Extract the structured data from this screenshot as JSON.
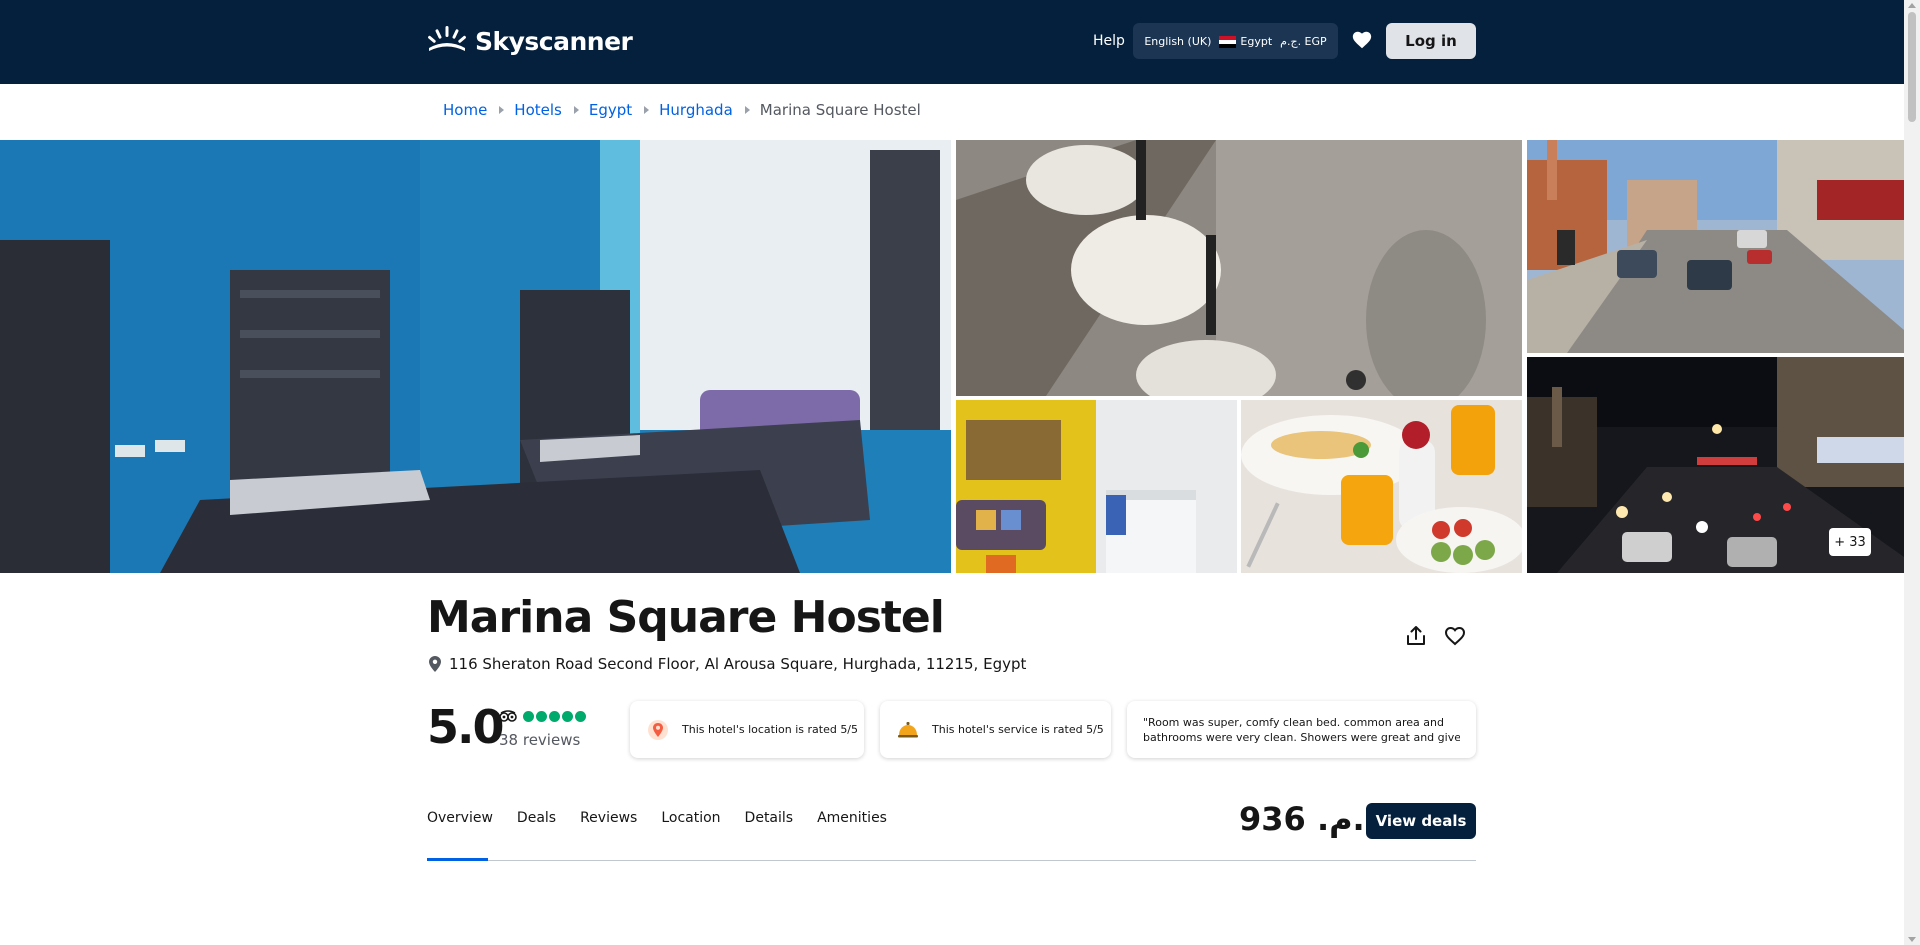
{
  "header": {
    "brand": "Skyscanner",
    "help_label": "Help",
    "language": "English (UK)",
    "country": "Egypt",
    "currency": "ج.م. EGP",
    "login_label": "Log in",
    "colors": {
      "background": "#05203c",
      "locale_background": "#1b3553",
      "login_background": "#e0e4e9"
    }
  },
  "breadcrumb": {
    "items": [
      "Home",
      "Hotels",
      "Egypt",
      "Hurghada"
    ],
    "current": "Marina Square Hostel"
  },
  "gallery": {
    "photos": [
      {
        "name": "bedroom-photo",
        "subject": "blue bedroom with twin beds"
      },
      {
        "name": "bathroom-sinks-photo",
        "subject": "bathroom vessel sinks"
      },
      {
        "name": "street-day-photo",
        "subject": "street view in daytime"
      },
      {
        "name": "reception-photo",
        "subject": "reception and lounge"
      },
      {
        "name": "breakfast-photo",
        "subject": "breakfast with orange juice"
      },
      {
        "name": "street-night-photo",
        "subject": "street view at night"
      }
    ],
    "more_count": "+ 33"
  },
  "hotel": {
    "name": "Marina Square Hostel",
    "address": "116 Sheraton Road Second Floor, Al Arousa Square, Hurghada, 11215, Egypt",
    "score": "5.0",
    "tripadvisor_bubbles": 5,
    "reviews": "38 reviews",
    "location_rating": "This hotel's location is rated 5/5",
    "service_rating": "This hotel's service is rated 5/5",
    "quote_line1": "\"Room was super, comfy clean bed. common area and",
    "quote_line2": "bathrooms were very clean. Showers were great and give..."
  },
  "tabs": [
    "Overview",
    "Deals",
    "Reviews",
    "Location",
    "Details",
    "Amenities"
  ],
  "active_tab": "Overview",
  "price": "ج.م. 936",
  "view_deals_label": "View deals",
  "colors": {
    "accent": "#0062e3",
    "rating_green": "#00aa6c",
    "button_dark": "#05203c"
  }
}
